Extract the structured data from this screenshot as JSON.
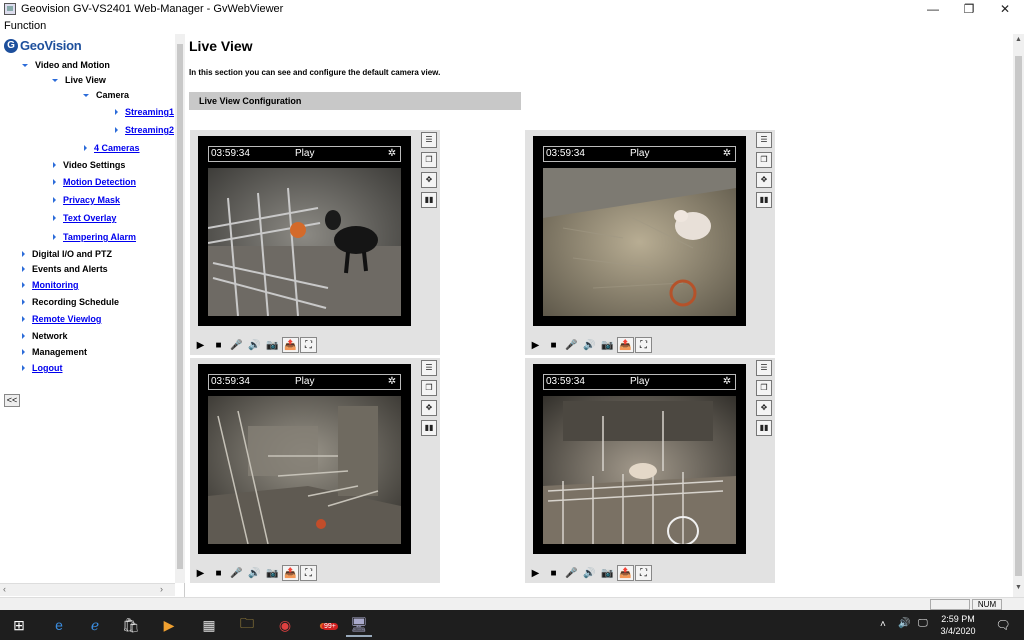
{
  "window": {
    "title": "Geovision GV-VS2401 Web-Manager - GvWebViewer",
    "minimize": "—",
    "maximize": "❐",
    "close": "✕"
  },
  "menu": {
    "function": "Function"
  },
  "logo": {
    "text": "GeoVision",
    "mark": "G"
  },
  "sidebar": {
    "items": [
      {
        "label": "Video and Motion",
        "link": false
      },
      {
        "label": "Live View",
        "link": false
      },
      {
        "label": "Camera",
        "link": false
      },
      {
        "label": "Streaming1",
        "link": true
      },
      {
        "label": "Streaming2",
        "link": true
      },
      {
        "label": "4 Cameras",
        "link": true
      },
      {
        "label": "Video Settings",
        "link": false
      },
      {
        "label": "Motion Detection",
        "link": true
      },
      {
        "label": "Privacy Mask",
        "link": true
      },
      {
        "label": "Text Overlay",
        "link": true
      },
      {
        "label": "Tampering Alarm",
        "link": true
      },
      {
        "label": "Digital I/O and PTZ",
        "link": false
      },
      {
        "label": "Events and Alerts",
        "link": false
      },
      {
        "label": "Monitoring",
        "link": true
      },
      {
        "label": "Recording Schedule",
        "link": false
      },
      {
        "label": "Remote Viewlog",
        "link": true
      },
      {
        "label": "Network",
        "link": false
      },
      {
        "label": "Management",
        "link": false
      },
      {
        "label": "Logout",
        "link": true
      }
    ],
    "collapse_label": "<<"
  },
  "main": {
    "title": "Live View",
    "description": "In this section you can see and configure the default camera view.",
    "section_header": "Live View Configuration"
  },
  "cameras": [
    {
      "time": "03:59:34",
      "state": "Play",
      "gear": "✲"
    },
    {
      "time": "03:59:34",
      "state": "Play",
      "gear": "✲"
    },
    {
      "time": "03:59:34",
      "state": "Play",
      "gear": "✲"
    },
    {
      "time": "03:59:34",
      "state": "Play",
      "gear": "✲"
    }
  ],
  "controls": {
    "play": "▶",
    "stop": "■",
    "mic": "🎤",
    "speaker": "🔊",
    "snapshot": "📷",
    "save": "📤",
    "fullscreen": "⛶"
  },
  "status": {
    "num": "NUM"
  },
  "taskbar": {
    "start": "⊞",
    "time": "2:59 PM",
    "date": "3/4/2020",
    "badge": "99+"
  },
  "colors": {
    "link": "#0000ee",
    "logo": "#1d4f9c",
    "tree_arrow": "#2c6cd9",
    "panel_gray": "#e2e2e2",
    "section_header": "#c8c8c8"
  }
}
